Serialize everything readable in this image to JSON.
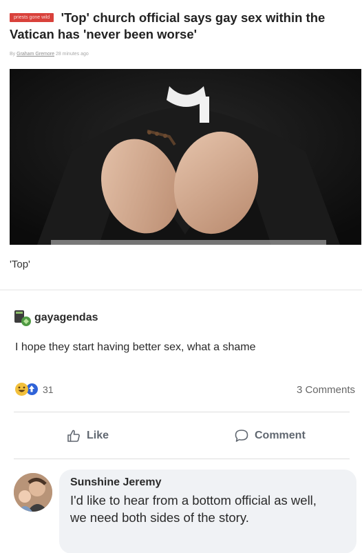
{
  "article": {
    "tag": "priests gone wild",
    "headline": "'Top' church official says gay sex within the Vatican has 'never been worse'",
    "byline_prefix": "By",
    "author": "Graham Gremore",
    "time": "28 minutes ago",
    "caption": "'Top'"
  },
  "post": {
    "author": "gayagendas",
    "author_icon": "sparkle-badge-icon",
    "text": "I hope they start having better sex, what a shame",
    "reaction_count": "31",
    "comments_count": "3 Comments",
    "reaction_icons": [
      "haha-reaction-icon",
      "upvote-reaction-icon"
    ]
  },
  "actions": {
    "like_label": "Like",
    "comment_label": "Comment"
  },
  "comment": {
    "name": "Sunshine Jeremy",
    "text": "I'd like to hear from a bottom official as well, we need both sides of the story."
  },
  "colors": {
    "tag_bg": "#d9413b",
    "upvote": "#2f63d8",
    "haha": "#f2c03c",
    "bubble_bg": "#f0f2f5"
  }
}
